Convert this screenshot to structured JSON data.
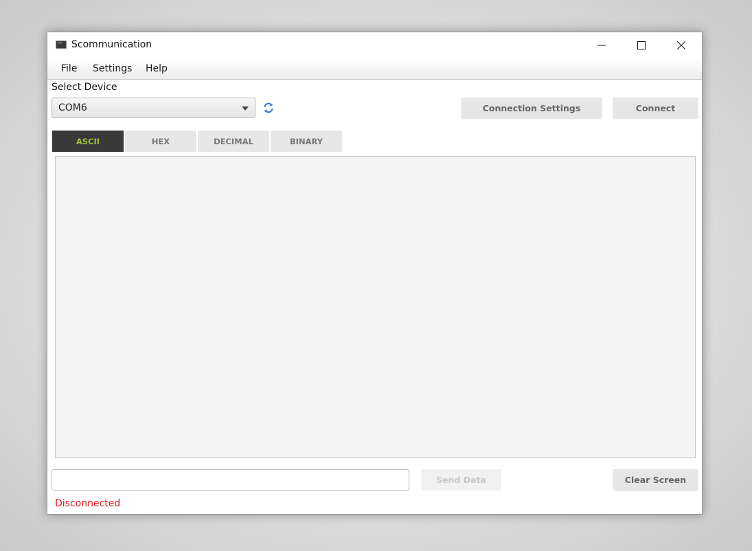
{
  "window": {
    "title": "Scommunication",
    "controls": {
      "minimize": "minimize-icon",
      "maximize": "maximize-icon",
      "close": "close-icon"
    }
  },
  "menu": {
    "items": [
      {
        "label": "File"
      },
      {
        "label": "Settings"
      },
      {
        "label": "Help"
      }
    ]
  },
  "device": {
    "label": "Select Device",
    "selected": "COM6",
    "refresh_icon": "refresh-icon"
  },
  "toolbar": {
    "connection_settings_label": "Connection Settings",
    "connect_label": "Connect"
  },
  "tabs": [
    {
      "label": "ASCII",
      "active": true
    },
    {
      "label": "HEX",
      "active": false
    },
    {
      "label": "DECIMAL",
      "active": false
    },
    {
      "label": "BINARY",
      "active": false
    }
  ],
  "output": {
    "text": ""
  },
  "send": {
    "input_value": "",
    "input_placeholder": "",
    "send_label": "Send Data",
    "send_enabled": false,
    "clear_label": "Clear Screen"
  },
  "status": {
    "text": "Disconnected",
    "color": "#e0161b"
  },
  "colors": {
    "active_tab_bg": "#393939",
    "active_tab_text": "#9cc23a",
    "refresh_icon": "#2a7bd4"
  }
}
